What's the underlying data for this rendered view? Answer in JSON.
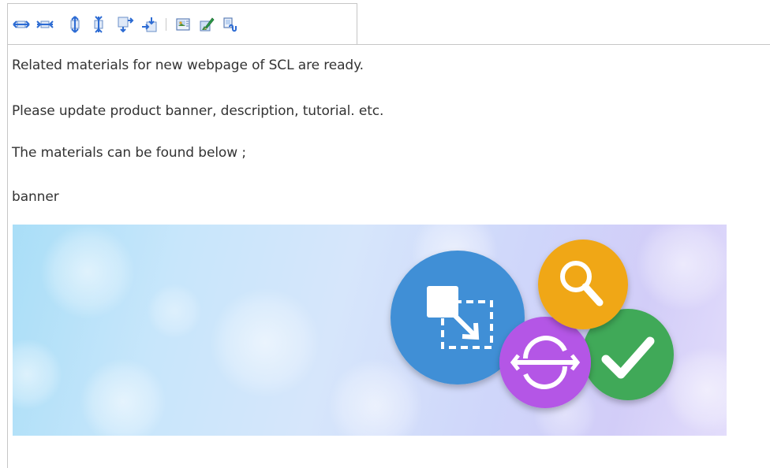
{
  "toolbar": {
    "buttons": [
      {
        "icon": "increase-width-icon"
      },
      {
        "icon": "decrease-width-icon"
      },
      {
        "icon": "increase-height-icon"
      },
      {
        "icon": "decrease-height-icon"
      },
      {
        "icon": "insert-row-below-icon"
      },
      {
        "icon": "insert-column-left-icon"
      },
      {
        "icon": "image-properties-icon"
      },
      {
        "icon": "edit-image-icon"
      },
      {
        "icon": "image-link-icon"
      }
    ],
    "icon_color": "#2c6bd3"
  },
  "content": {
    "line1": "Related materials for new webpage of SCL are ready.",
    "line2": "Please update product banner, description, tutorial. etc.",
    "line3": "The materials can be found below ;",
    "line4": "banner"
  },
  "banner": {
    "circles": [
      {
        "icon": "resize-arrow-icon",
        "color": "#3f8fd6"
      },
      {
        "icon": "magnifier-icon",
        "color": "#f0a716"
      },
      {
        "icon": "sync-icon",
        "color": "#b457e6"
      },
      {
        "icon": "checkmark-icon",
        "color": "#3fa958"
      }
    ]
  }
}
